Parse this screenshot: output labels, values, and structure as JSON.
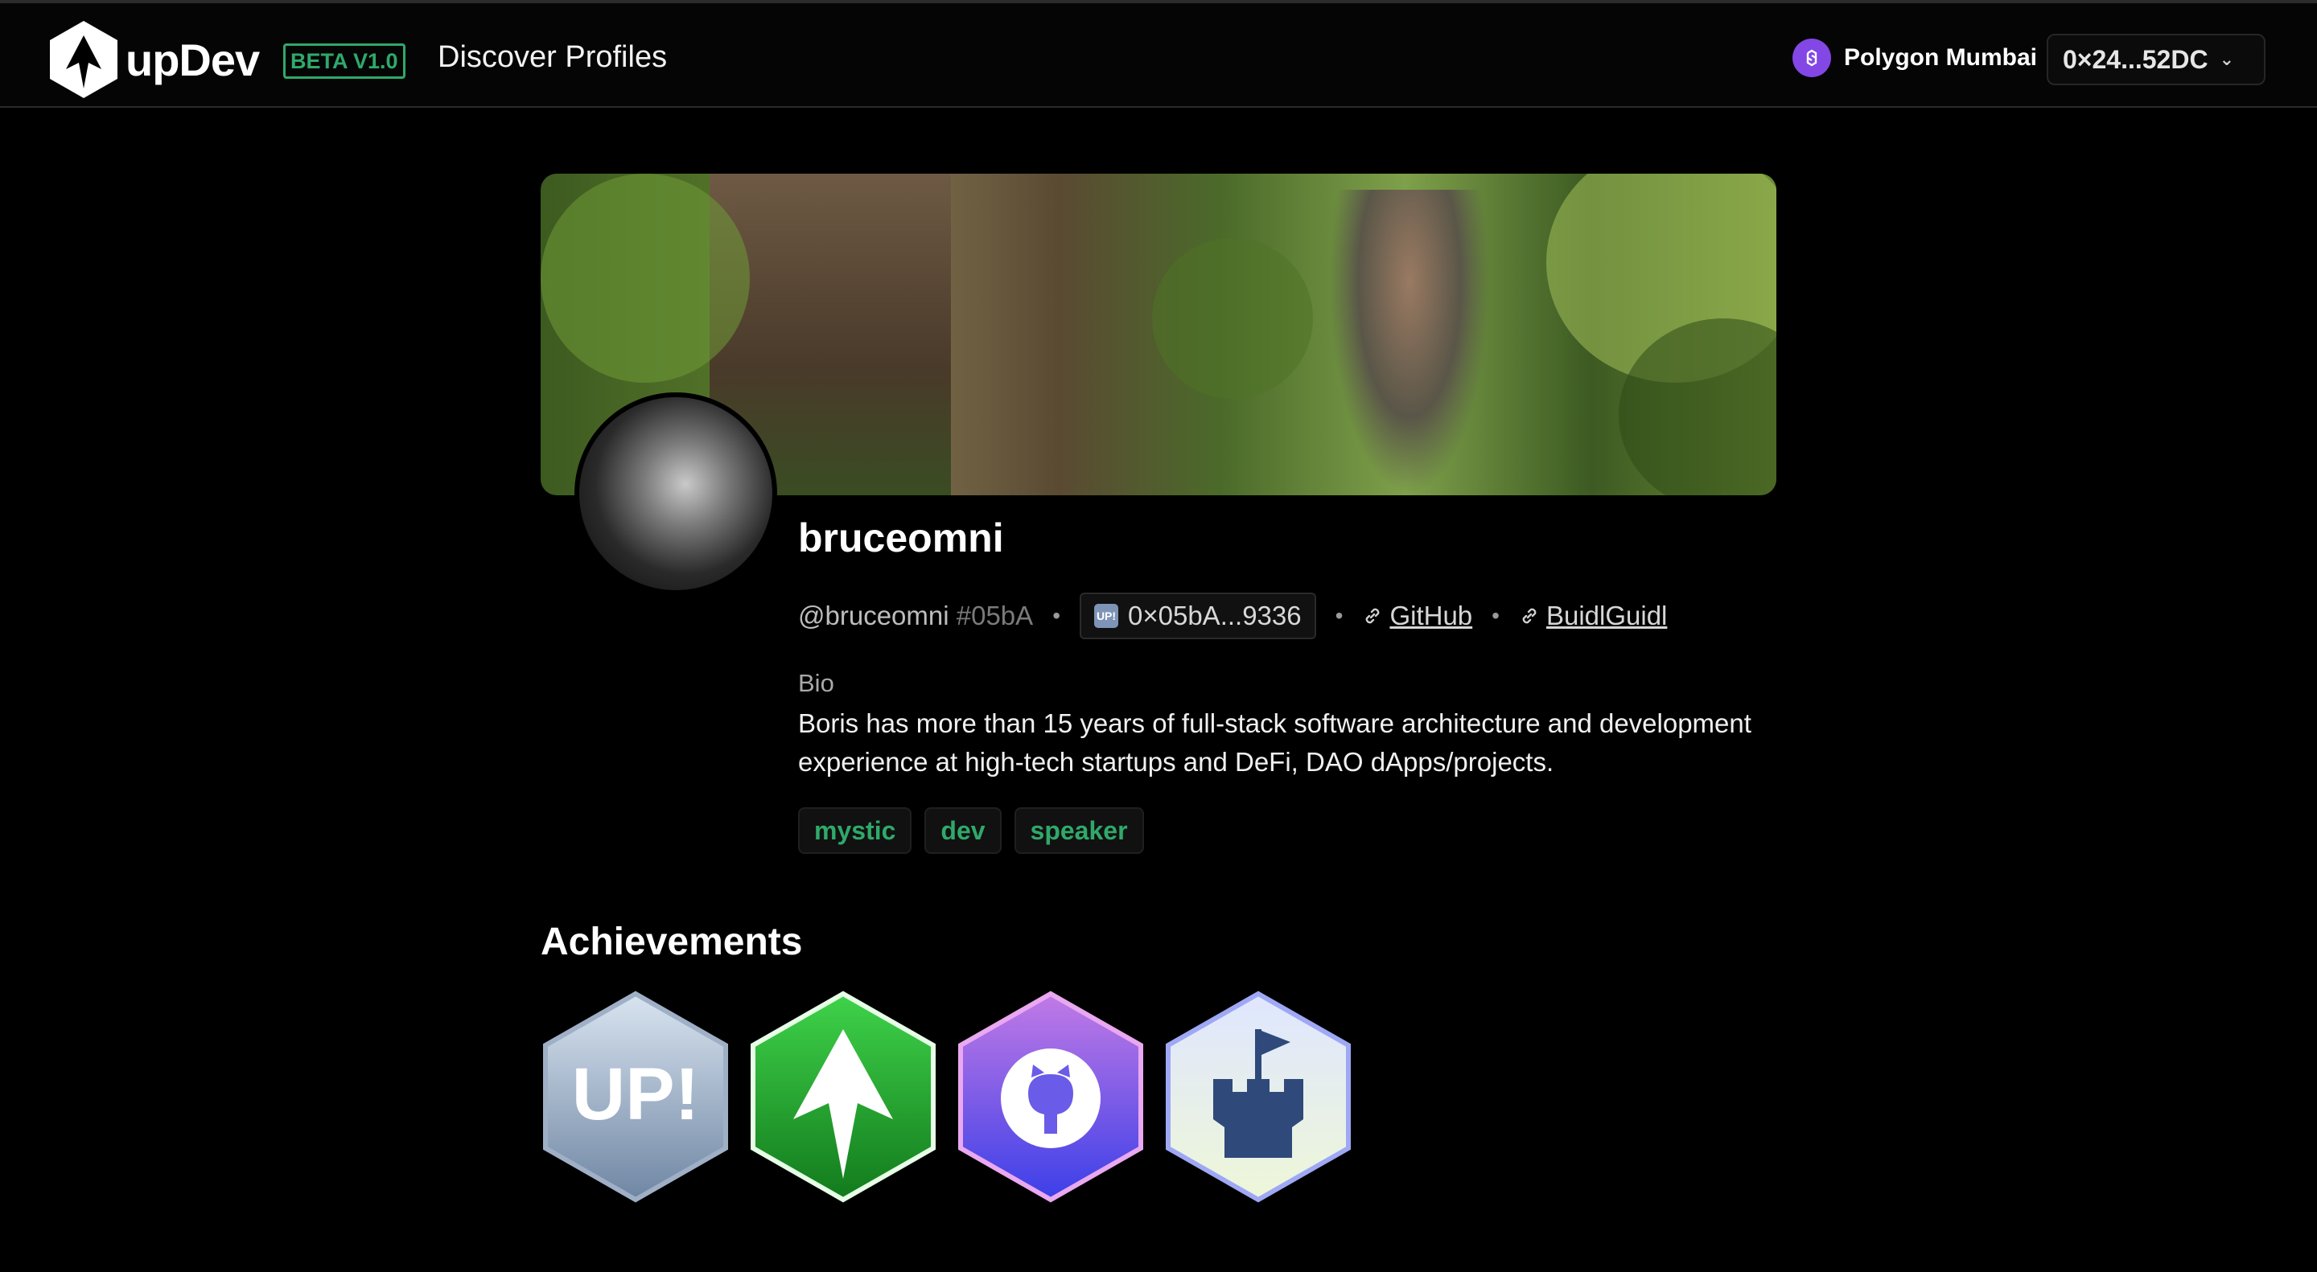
{
  "header": {
    "brand": "upDev",
    "beta": "BETA V1.0",
    "nav_discover": "Discover Profiles",
    "network": "Polygon Mumbai",
    "wallet": "0×24...52DC"
  },
  "profile": {
    "name": "bruceomni",
    "handle": "@bruceomni",
    "hash": "#05bA",
    "address": "0×05bA...9336",
    "address_icon": "UP!",
    "links": [
      {
        "label": "GitHub"
      },
      {
        "label": "BuidlGuidl"
      }
    ],
    "bio_label": "Bio",
    "bio": "Boris has more than 15 years of full-stack software architecture and development experience at high-tech startups and DeFi, DAO dApps/projects.",
    "tags": [
      "mystic",
      "dev",
      "speaker"
    ]
  },
  "achievements": {
    "title": "Achievements",
    "badges": [
      {
        "icon": "up-badge-icon",
        "label": "UP!"
      },
      {
        "icon": "updev-badge-icon"
      },
      {
        "icon": "github-badge-icon"
      },
      {
        "icon": "buidlguidl-badge-icon"
      }
    ]
  },
  "colors": {
    "accent_green": "#2fa96a",
    "polygon_purple": "#8247e5",
    "background": "#000000"
  }
}
